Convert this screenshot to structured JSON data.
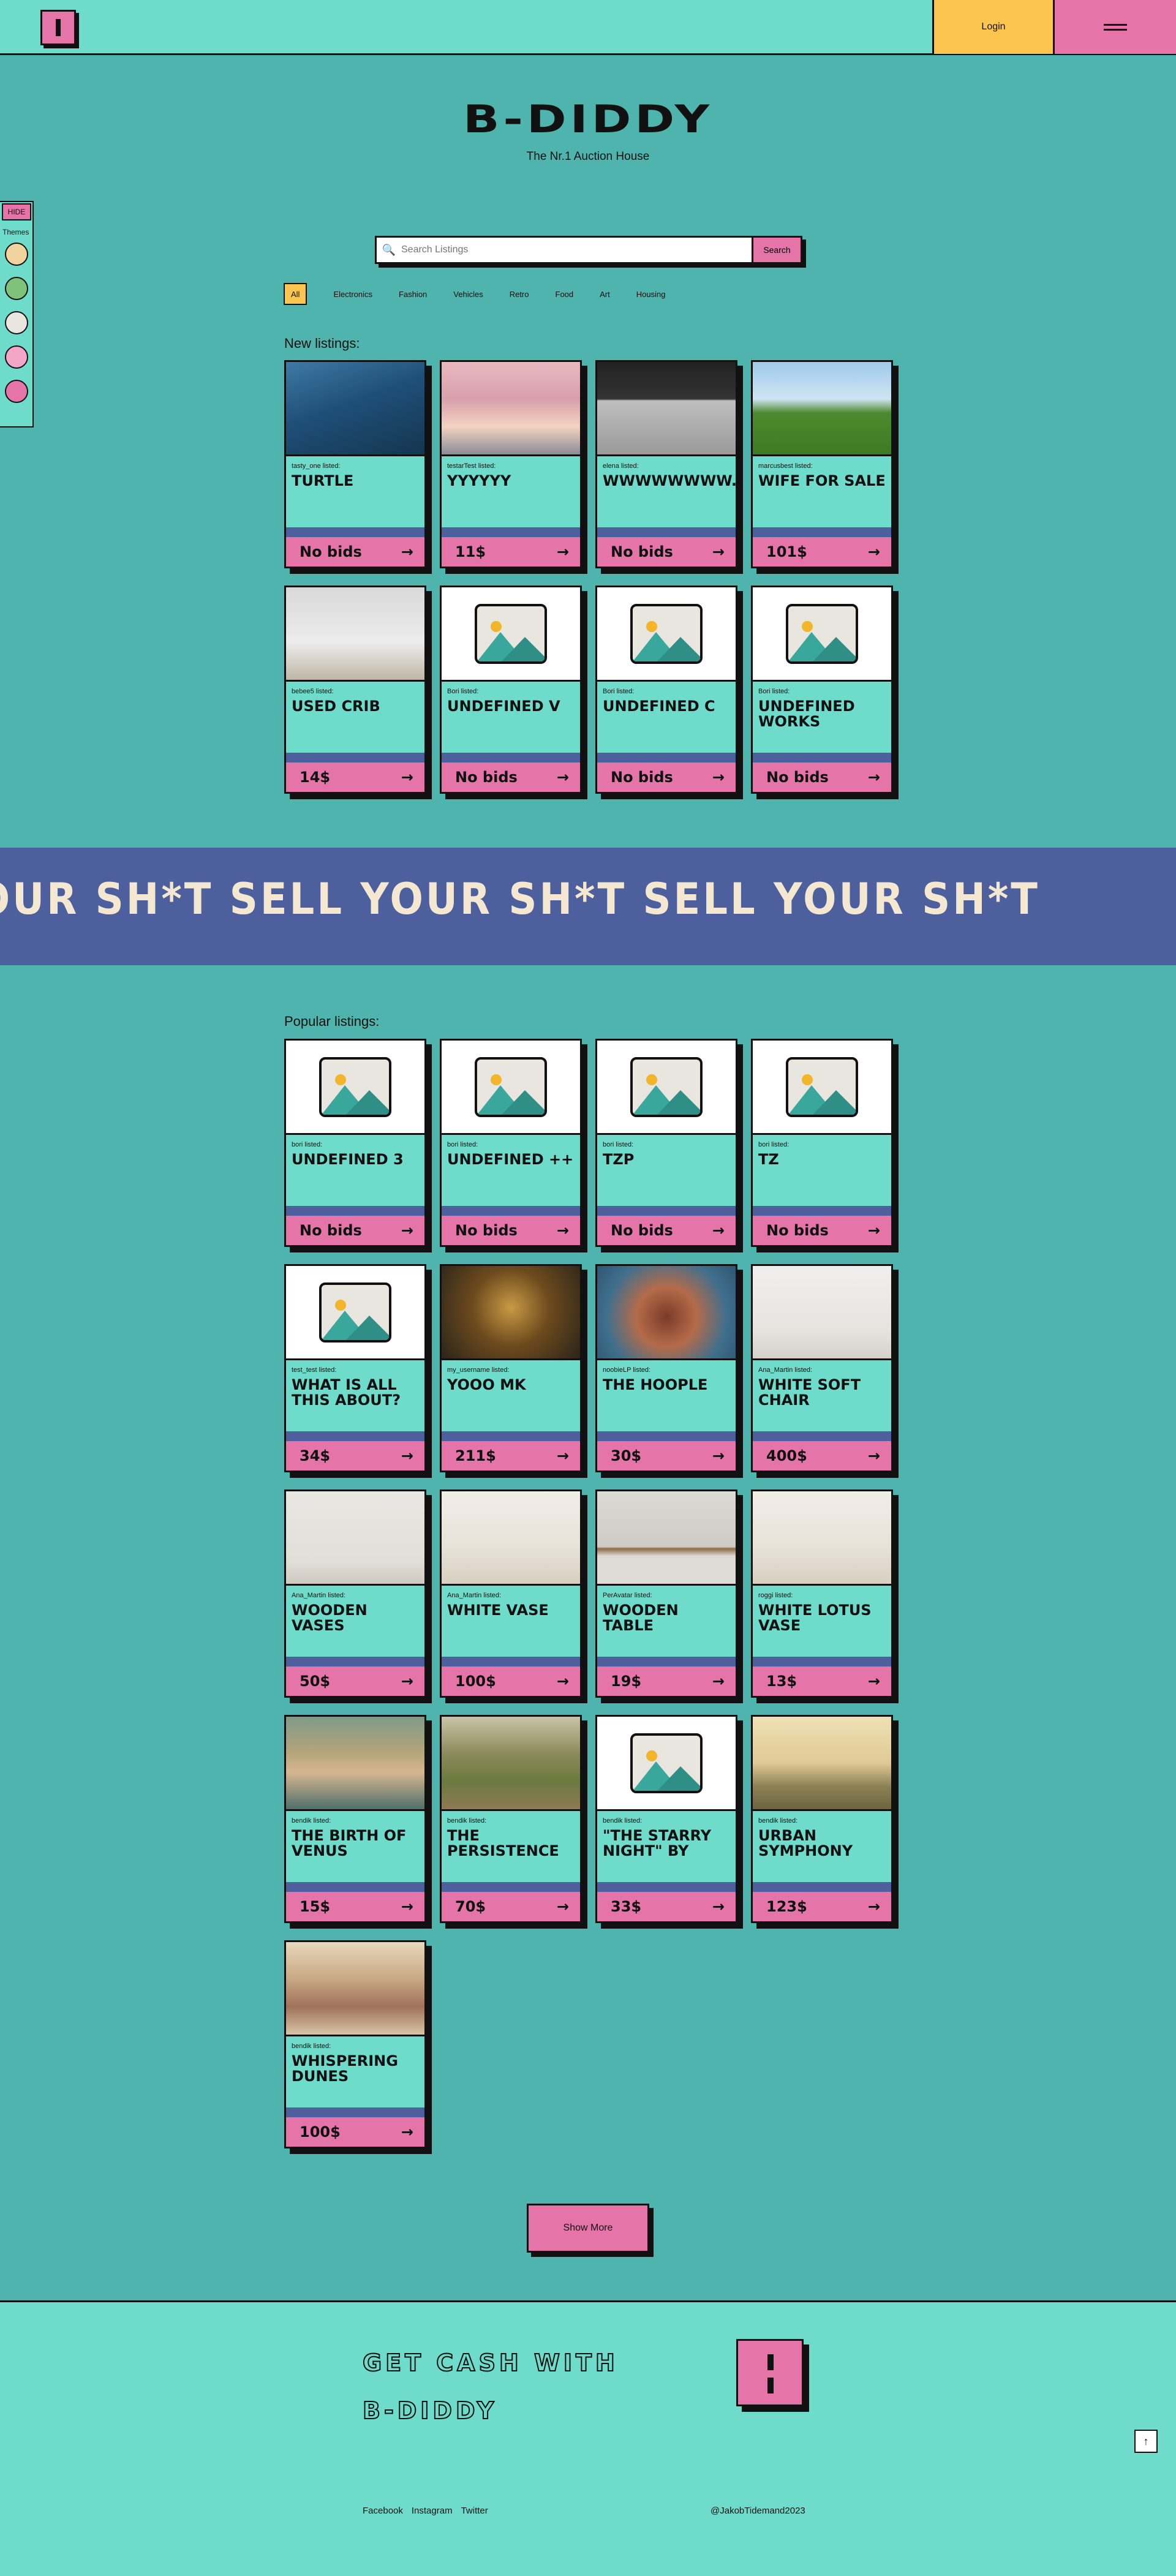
{
  "header": {
    "login_label": "Login"
  },
  "hero": {
    "brand": "B-DIDDY",
    "tagline": "The Nr.1 Auction House"
  },
  "themes": {
    "hide_label": "HIDE",
    "label": "Themes"
  },
  "search": {
    "placeholder": "Search Listings",
    "button_label": "Search"
  },
  "categories": [
    "All",
    "Electronics",
    "Fashion",
    "Vehicles",
    "Retro",
    "Food",
    "Art",
    "Housing"
  ],
  "new_listings": {
    "heading": "New listings:",
    "items": [
      {
        "seller": "tasty_one listed:",
        "title": "TURTLE",
        "price": "No bids",
        "image": "turtle-photo"
      },
      {
        "seller": "testarTest listed:",
        "title": "YYYYYY",
        "price": "11$",
        "image": "sky-photo"
      },
      {
        "seller": "elena listed:",
        "title": "WWWWWWWW...",
        "price": "No bids",
        "image": "laptop-photo"
      },
      {
        "seller": "marcusbest listed:",
        "title": "WIFE FOR SALE",
        "price": "101$",
        "image": "cow-photo"
      },
      {
        "seller": "bebee5 listed:",
        "title": "USED CRIB",
        "price": "14$",
        "image": "crib-photo"
      },
      {
        "seller": "Bori listed:",
        "title": "UNDEFINED V",
        "price": "No bids",
        "image": "placeholder"
      },
      {
        "seller": "Bori listed:",
        "title": "UNDEFINED C",
        "price": "No bids",
        "image": "placeholder"
      },
      {
        "seller": "Bori listed:",
        "title": "UNDEFINED WORKS",
        "price": "No bids",
        "image": "placeholder"
      }
    ]
  },
  "marquee": {
    "text": "SELL YOUR SH*T   SELL YOUR SH*T   SELL YOUR SH*T"
  },
  "popular_listings": {
    "heading": "Popular listings:",
    "items": [
      {
        "seller": "bori listed:",
        "title": "UNDEFINED 3",
        "price": "No bids",
        "image": "placeholder"
      },
      {
        "seller": "bori listed:",
        "title": "UNDEFINED ++",
        "price": "No bids",
        "image": "placeholder"
      },
      {
        "seller": "bori listed:",
        "title": "TZP",
        "price": "No bids",
        "image": "placeholder"
      },
      {
        "seller": "bori listed:",
        "title": "TZ",
        "price": "No bids",
        "image": "placeholder"
      },
      {
        "seller": "test_test listed:",
        "title": "WHAT IS ALL THIS ABOUT?",
        "price": "34$",
        "image": "placeholder"
      },
      {
        "seller": "my_username listed:",
        "title": "YOOO MK",
        "price": "211$",
        "image": "mona-lisa-photo"
      },
      {
        "seller": "noobieLP listed:",
        "title": "THE HOOPLE",
        "price": "30$",
        "image": "hoople-photo"
      },
      {
        "seller": "Ana_Martin listed:",
        "title": "WHITE SOFT CHAIR",
        "price": "400$",
        "image": "chair-photo"
      },
      {
        "seller": "Ana_Martin listed:",
        "title": "WOODEN VASES",
        "price": "50$",
        "image": "plant-photo"
      },
      {
        "seller": "Ana_Martin listed:",
        "title": "WHITE VASE",
        "price": "100$",
        "image": "vase-photo"
      },
      {
        "seller": "PerAvatar listed:",
        "title": "WOODEN TABLE",
        "price": "19$",
        "image": "table-photo"
      },
      {
        "seller": "roggi listed:",
        "title": "WHITE LOTUS VASE",
        "price": "13$",
        "image": "vase-photo"
      },
      {
        "seller": "bendik listed:",
        "title": "THE BIRTH OF VENUS",
        "price": "15$",
        "image": "venus-painting"
      },
      {
        "seller": "bendik listed:",
        "title": "THE PERSISTENCE",
        "price": "70$",
        "image": "cottage-painting"
      },
      {
        "seller": "bendik listed:",
        "title": "\"THE STARRY NIGHT\" BY",
        "price": "33$",
        "image": "placeholder"
      },
      {
        "seller": "bendik listed:",
        "title": "URBAN SYMPHONY",
        "price": "123$",
        "image": "landscape-painting"
      },
      {
        "seller": "bendik listed:",
        "title": "WHISPERING DUNES",
        "price": "100$",
        "image": "street-painting"
      }
    ]
  },
  "show_more": "Show More",
  "footer": {
    "slogan_line1": "GET CASH WITH",
    "slogan_line2": "B-DIDDY",
    "to_top": "↑",
    "links": [
      "Facebook",
      "Instagram",
      "Twitter"
    ],
    "credit": "@JakobTidemand2023"
  }
}
